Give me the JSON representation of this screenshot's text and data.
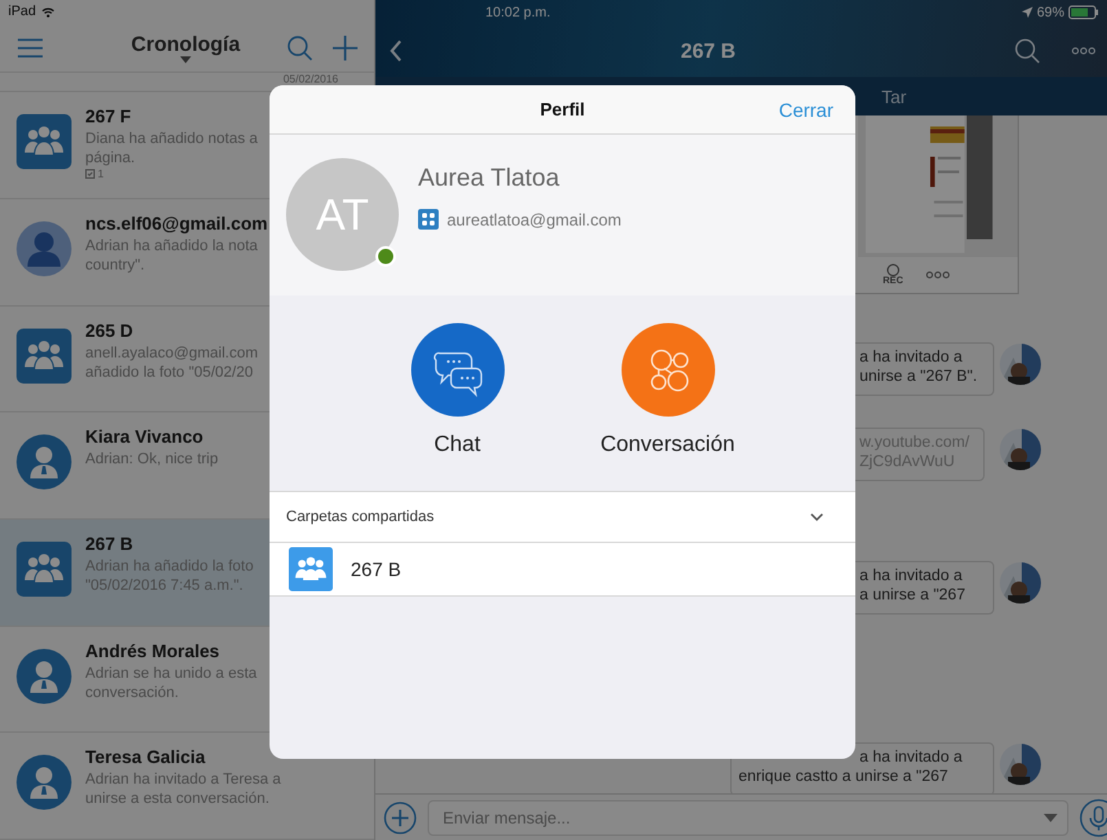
{
  "status_bar": {
    "device": "iPad",
    "time": "10:02 p.m.",
    "battery": "69%"
  },
  "sidebar": {
    "title": "Cronología",
    "date": "05/02/2016",
    "items": [
      {
        "kind": "group",
        "title": "267 F",
        "lines": [
          "Diana ha añadido notas a",
          "página."
        ],
        "note_count": "1",
        "selected": false
      },
      {
        "kind": "user",
        "title": "ncs.elf06@gmail.com",
        "lines": [
          "Adrian ha añadido la nota",
          "country\"."
        ],
        "selected": false
      },
      {
        "kind": "group",
        "title": "265 D",
        "lines": [
          "anell.ayalaco@gmail.com",
          "añadido la foto \"05/02/20"
        ],
        "selected": false
      },
      {
        "kind": "contact",
        "title": "Kiara Vivanco",
        "lines": [
          "Adrian: Ok, nice trip"
        ],
        "selected": false
      },
      {
        "kind": "group",
        "title": "267 B",
        "lines": [
          "Adrian ha añadido la foto",
          "\"05/02/2016 7:45 a.m.\"."
        ],
        "selected": true
      },
      {
        "kind": "contact",
        "title": "Andrés Morales",
        "lines": [
          "Adrian se ha unido a esta",
          "conversación."
        ],
        "selected": false
      },
      {
        "kind": "contact",
        "title": "Teresa Galicia",
        "lines": [
          "Adrian ha invitado a Teresa a",
          "unirse a esta conversación."
        ],
        "selected": false
      }
    ]
  },
  "conversation": {
    "title": "267 B",
    "tabs": [
      {
        "label": "Tar",
        "selected": false
      }
    ],
    "attachment": {
      "kind": "picture",
      "rec_label": "REC"
    },
    "messages": [
      {
        "kind": "text",
        "lines": [
          "a ha invitado a",
          "unirse a \"267 B\"."
        ]
      },
      {
        "kind": "link",
        "lines": [
          "w.youtube.com/",
          "ZjC9dAvWuU"
        ]
      },
      {
        "kind": "text",
        "lines": [
          "a ha invitado a",
          "a unirse a \"267"
        ]
      },
      {
        "kind": "text",
        "lines": [
          "a ha invitado a",
          "enrique castto a unirse a \"267"
        ]
      }
    ],
    "composer": {
      "placeholder": "Enviar mensaje..."
    }
  },
  "profile_dialog": {
    "title": "Perfil",
    "close": "Cerrar",
    "initials": "AT",
    "online": true,
    "name": "Aurea Tlatoa",
    "email": "aureatlatoa@gmail.com",
    "actions": [
      {
        "kind": "chat",
        "label": "Chat"
      },
      {
        "kind": "conversation",
        "label": "Conversación"
      }
    ],
    "shared_folders": {
      "title": "Carpetas compartidas",
      "expanded": true,
      "items": [
        {
          "name": "267 B"
        }
      ]
    }
  }
}
